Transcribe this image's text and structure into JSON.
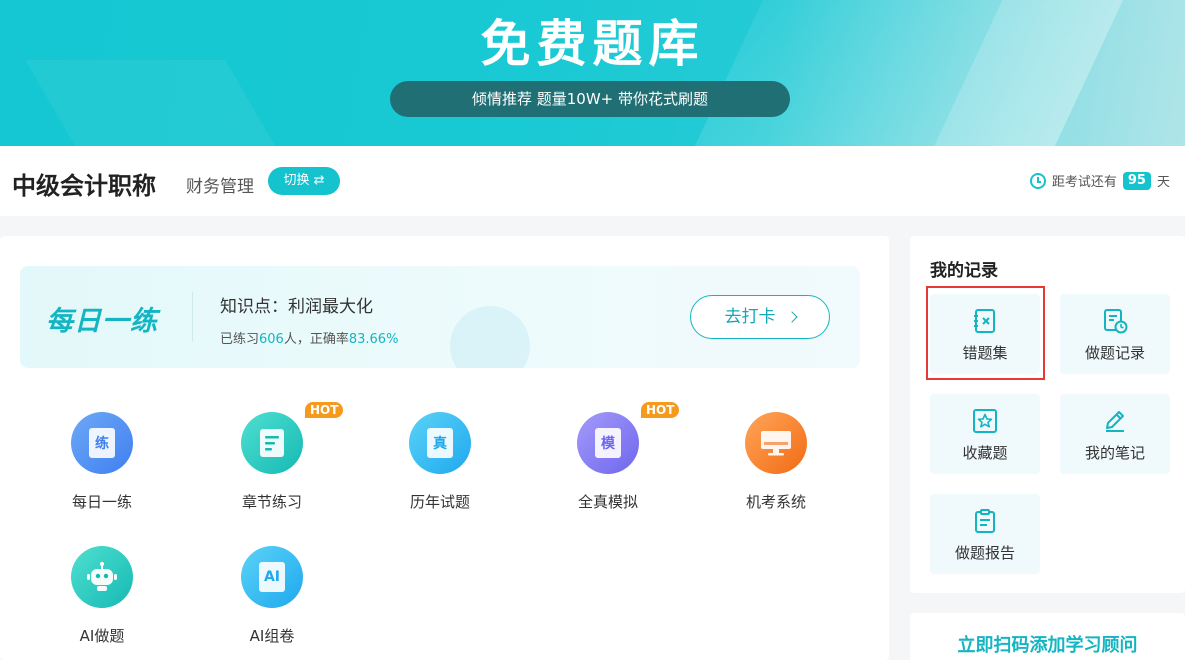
{
  "banner": {
    "title": "免费题库",
    "subtitle": "倾情推荐 题量10W+ 带你花式刷题"
  },
  "header": {
    "exam_title": "中级会计职称",
    "subject": "财务管理",
    "switch_label": "切换 ⇄",
    "countdown_prefix": "距考试还有",
    "countdown_days": "95",
    "countdown_suffix": "天"
  },
  "daily": {
    "logo": "每日一练",
    "kp_label": "知识点：利润最大化",
    "stats_prefix": "已练习",
    "stats_count": "606",
    "stats_mid": "人，正确率",
    "stats_rate": "83.66%",
    "checkin_label": "去打卡"
  },
  "features": [
    {
      "label": "每日一练",
      "glyph": "练",
      "hot": false
    },
    {
      "label": "章节练习",
      "glyph": "",
      "hot": true,
      "hot_label": "HOT"
    },
    {
      "label": "历年试题",
      "glyph": "真",
      "hot": false
    },
    {
      "label": "全真模拟",
      "glyph": "模",
      "hot": true,
      "hot_label": "HOT"
    },
    {
      "label": "机考系统",
      "glyph": "",
      "hot": false
    },
    {
      "label": "AI做题",
      "glyph": "",
      "hot": false
    },
    {
      "label": "AI组卷",
      "glyph": "AI",
      "hot": false
    }
  ],
  "records": {
    "title": "我的记录",
    "items": [
      {
        "label": "错题集",
        "icon": "wrong-notebook-icon"
      },
      {
        "label": "做题记录",
        "icon": "history-clock-icon"
      },
      {
        "label": "收藏题",
        "icon": "star-icon"
      },
      {
        "label": "我的笔记",
        "icon": "pencil-icon"
      },
      {
        "label": "做题报告",
        "icon": "report-icon"
      }
    ]
  },
  "consult": {
    "label": "立即扫码添加学习顾问"
  },
  "colors": {
    "accent": "#14c3cd",
    "hot": "#f59a1d",
    "highlight": "#e53935"
  }
}
